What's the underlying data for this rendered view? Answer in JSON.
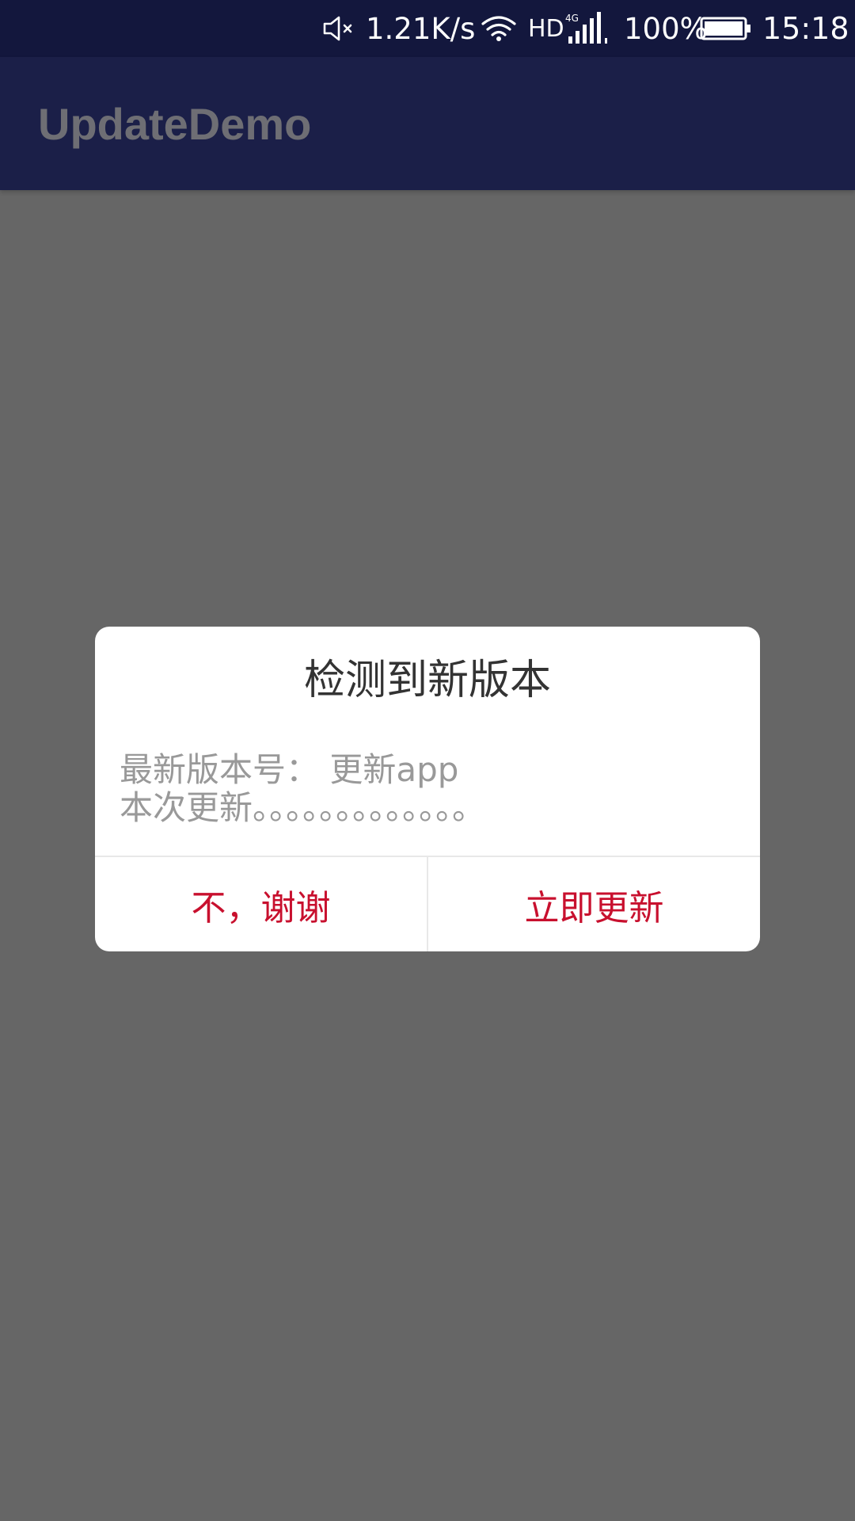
{
  "status_bar": {
    "network_speed": "1.21K/s",
    "hd_label": "HD",
    "network_type": "4G",
    "battery_percent": "100%",
    "time": "15:18",
    "icons": [
      "mute-icon",
      "wifi-icon",
      "signal-icon",
      "battery-icon"
    ]
  },
  "toolbar": {
    "title": "UpdateDemo"
  },
  "dialog": {
    "title": "检测到新版本",
    "version_line": "最新版本号： 更新app",
    "notes_line": "本次更新。。。。。。。。。。。。。",
    "cancel_label": "不，谢谢",
    "update_label": "立即更新"
  },
  "colors": {
    "status_bar_bg": "#13173d",
    "toolbar_bg": "#1b1f48",
    "overlay_bg": "#666666",
    "button_text": "#c8102e"
  }
}
